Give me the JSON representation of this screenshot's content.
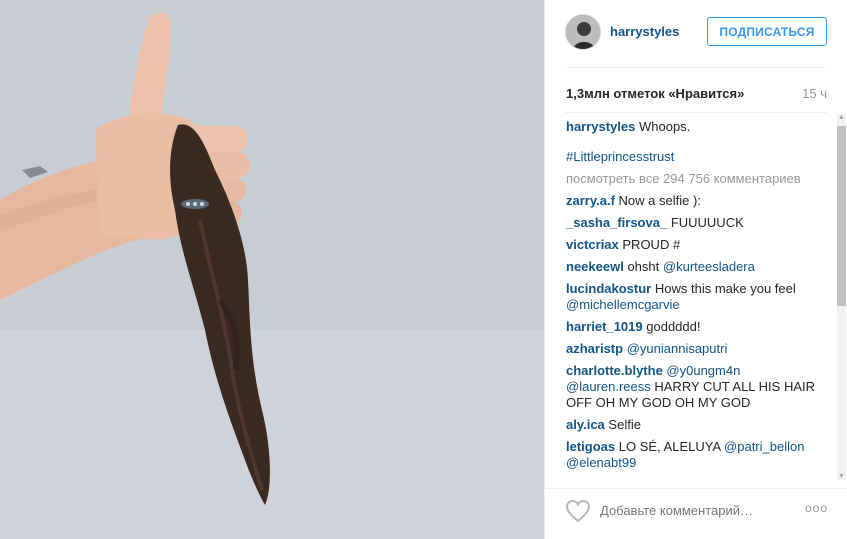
{
  "post": {
    "username": "harrystyles",
    "follow_label": "ПОДПИСАТЬСЯ",
    "likes": "1,3млн отметок «Нравится»",
    "time": "15 ч",
    "caption_user": "harrystyles",
    "caption_text": "Whoops.",
    "hashtag": "#Littleprincesstrust",
    "view_all": "посмотреть все 294 756 комментариев",
    "comment_placeholder": "Добавьте комментарий…",
    "more_icon": "ooo"
  },
  "comments": [
    {
      "user": "zarry.a.f",
      "text": "Now a selfie ):"
    },
    {
      "user": "_sasha_firsova_",
      "text": "FUUUUUCK"
    },
    {
      "user": "victcriax",
      "text": "PROUD #"
    },
    {
      "user": "neekeewl",
      "text": "ohsht",
      "mention": "@kurteesladera"
    },
    {
      "user": "lucindakostur",
      "text": "Hows this make you feel",
      "mention": "@michellemcgarvie"
    },
    {
      "user": "harriet_1019",
      "text": "goddddd!"
    },
    {
      "user": "azharistp",
      "text": "",
      "mention": "@yuniannisaputri"
    },
    {
      "user": "charlotte.blythe",
      "text": "",
      "mention": "@y0ungm4n",
      "mention2": "@lauren.reess",
      "text2": "HARRY CUT ALL HIS HAIR OFF OH MY GOD OH MY GOD"
    },
    {
      "user": "aly.ica",
      "text": "Selfie"
    },
    {
      "user": "letigoas",
      "text": "LO SÉ, ALELUYA",
      "mention": "@patri_bellon",
      "mention2": "@elenabt99"
    }
  ],
  "icons": {
    "heart": "heart-outline-icon",
    "more": "more-options-icon"
  },
  "colors": {
    "link": "#125688",
    "follow": "#3897f0",
    "muted": "#999999"
  }
}
